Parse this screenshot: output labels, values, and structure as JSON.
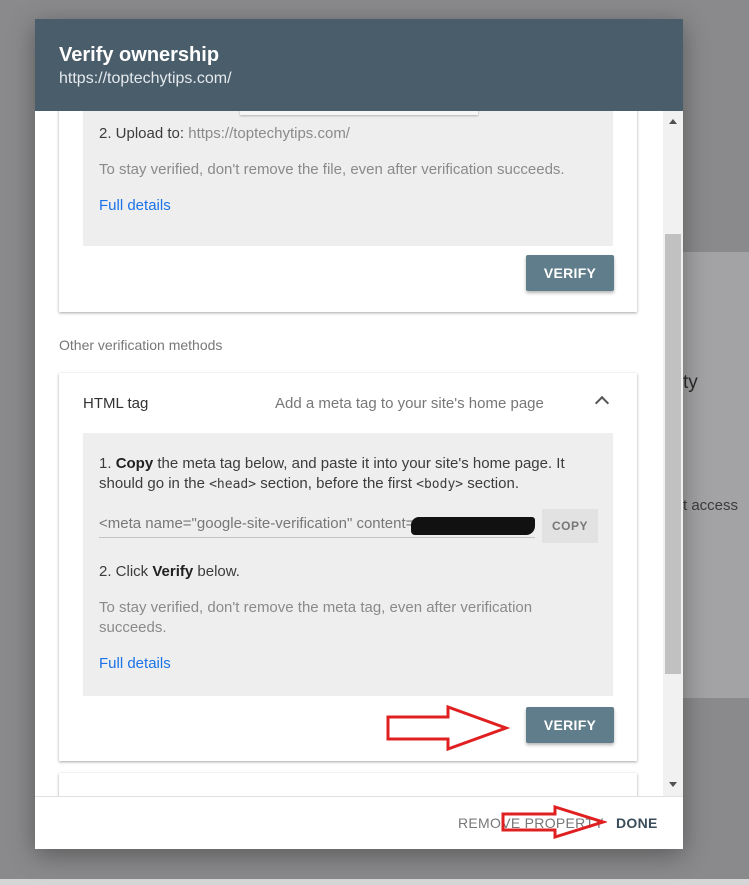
{
  "background": {
    "partial_text_1": "ty",
    "partial_text_2": "t access"
  },
  "dialog": {
    "title": "Verify ownership",
    "subtitle": "https://toptechytips.com/"
  },
  "file_method": {
    "step2_label": "2. Upload to:",
    "step2_url": "https://toptechytips.com/",
    "stay_verified": "To stay verified, don't remove the file, even after verification succeeds.",
    "full_details": "Full details",
    "verify_label": "VERIFY"
  },
  "other_methods_label": "Other verification methods",
  "html_tag_method": {
    "title": "HTML tag",
    "description": "Add a meta tag to your site's home page",
    "step1_num": "1.",
    "step1_bold": "Copy",
    "step1_rest": "the meta tag below, and paste it into your site's home page. It",
    "step1_line2_a": "should go in the",
    "step1_code1": "<head>",
    "step1_line2_b": "section, before the first",
    "step1_code2": "<body>",
    "step1_line2_c": "section.",
    "meta_tag": "<meta name=\"google-site-verification\" content=",
    "copy_label": "COPY",
    "step2_prefix": "2. Click",
    "step2_bold": "Verify",
    "step2_suffix": "below.",
    "stay_verified_line1": "To stay verified, don't remove the meta tag, even after verification",
    "stay_verified_line2": "succeeds.",
    "full_details": "Full details",
    "verify_label": "VERIFY"
  },
  "footer": {
    "remove_label": "REMOVE PROPERTY",
    "done_label": "DONE"
  },
  "colors": {
    "header_bg": "#4a5d6a",
    "verify_bg": "#607d8b",
    "link": "#1a73e8",
    "annotation_arrow": "#e02020"
  }
}
